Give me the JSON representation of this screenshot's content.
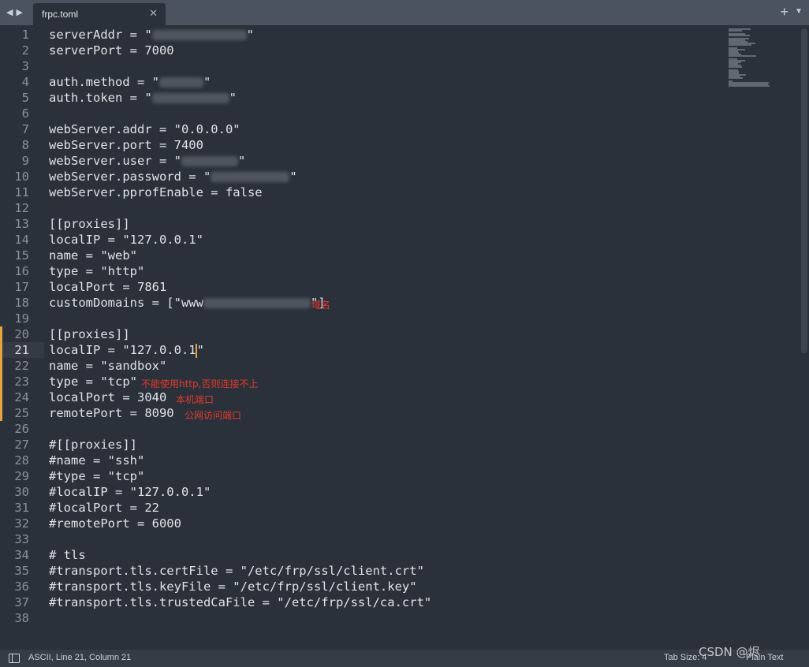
{
  "tab": {
    "label": "frpc.toml",
    "close": "✕",
    "add": "+",
    "menu": "▼",
    "back": "◀",
    "forward": "▶"
  },
  "status": {
    "text": "ASCII, Line 21, Column 21",
    "tab_size": "Tab Size: 4",
    "syntax": "Plain Text"
  },
  "watermark": "CSDN @烬",
  "notes": {
    "domain": "域名",
    "no_http": "不能使用http,否则连接不上",
    "local_port": "本机端口",
    "public_port": "公网访问端口"
  },
  "lines": [
    {
      "n": "1",
      "code": "serverAddr = \"",
      "secret": "xxx.xxx.xx.xx",
      "after": "\""
    },
    {
      "n": "2",
      "code": "serverPort = 7000"
    },
    {
      "n": "3",
      "code": ""
    },
    {
      "n": "4",
      "code": "auth.method = \"",
      "secret": "token",
      "after": "\""
    },
    {
      "n": "5",
      "code": "auth.token = \"",
      "secret": "tokenxxxxxxx",
      "after": "\""
    },
    {
      "n": "6",
      "code": ""
    },
    {
      "n": "7",
      "code": "webServer.addr = \"0.0.0.0\""
    },
    {
      "n": "8",
      "code": "webServer.port = 7400"
    },
    {
      "n": "9",
      "code": "webServer.user = \"",
      "secret": "admin",
      "after": "\""
    },
    {
      "n": "10",
      "code": "webServer.password = \"",
      "secret": "xxxxxxxxxxx",
      "after": "\""
    },
    {
      "n": "11",
      "code": "webServer.pprofEnable = false"
    },
    {
      "n": "12",
      "code": ""
    },
    {
      "n": "13",
      "code": "[[proxies]]"
    },
    {
      "n": "14",
      "code": "localIP = \"127.0.0.1\""
    },
    {
      "n": "15",
      "code": "name = \"web\""
    },
    {
      "n": "16",
      "code": "type = \"http\""
    },
    {
      "n": "17",
      "code": "localPort = 7861"
    },
    {
      "n": "18",
      "code": "customDomains = [\"www",
      "secret": "xxxxxxxxxxxx",
      "after": "\"]"
    },
    {
      "n": "19",
      "code": ""
    },
    {
      "n": "20",
      "code": "[[proxies]]"
    },
    {
      "n": "21",
      "code": "localIP = \"127.0.0.1",
      "after_cursor": "\""
    },
    {
      "n": "22",
      "code": "name = \"sandbox\""
    },
    {
      "n": "23",
      "code": "type = \"tcp\""
    },
    {
      "n": "24",
      "code": "localPort = 3040"
    },
    {
      "n": "25",
      "code": "remotePort = 8090"
    },
    {
      "n": "26",
      "code": ""
    },
    {
      "n": "27",
      "code": "#[[proxies]]"
    },
    {
      "n": "28",
      "code": "#name = \"ssh\""
    },
    {
      "n": "29",
      "code": "#type = \"tcp\""
    },
    {
      "n": "30",
      "code": "#localIP = \"127.0.0.1\""
    },
    {
      "n": "31",
      "code": "#localPort = 22"
    },
    {
      "n": "32",
      "code": "#remotePort = 6000"
    },
    {
      "n": "33",
      "code": ""
    },
    {
      "n": "34",
      "code": "# tls"
    },
    {
      "n": "35",
      "code": "#transport.tls.certFile = \"/etc/frp/ssl/client.crt\""
    },
    {
      "n": "36",
      "code": "#transport.tls.keyFile = \"/etc/frp/ssl/client.key\""
    },
    {
      "n": "37",
      "code": "#transport.tls.trustedCaFile = \"/etc/frp/ssl/ca.crt\""
    },
    {
      "n": "38",
      "code": ""
    }
  ],
  "colors": {
    "background": "#2b313a",
    "tabbar": "#4b535e",
    "gutter_modified": "#e5a340",
    "annotation": "#e03a2e"
  }
}
